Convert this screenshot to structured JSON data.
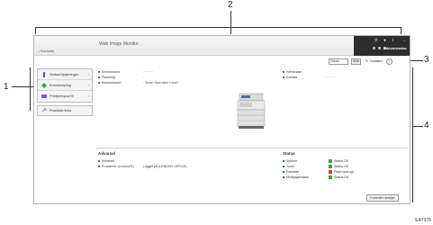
{
  "callouts": [
    "1",
    "2",
    "3",
    "4"
  ],
  "header": {
    "top_link": "• Startside",
    "app_title": "Web Image Monitor",
    "admin_label": "Administrator",
    "icons": [
      "search-icon",
      "user-icon",
      "info-icon",
      "logout-icon"
    ]
  },
  "toolbar": {
    "language": "Dansk",
    "small_button": "Skift",
    "refresh_label": "Opdatér",
    "help_label": "?"
  },
  "sidebar": {
    "items": [
      {
        "label": "Status/Oplysninger",
        "icon": "status-icon"
      },
      {
        "label": "Enhedsstyring",
        "icon": "device-icon"
      },
      {
        "label": "Printjob/spool fil",
        "icon": "printjob-icon"
      }
    ],
    "single": {
      "label": "Praktiske links",
      "icon": "link-icon"
    }
  },
  "main": {
    "info": [
      {
        "label": "Enhedsnavn",
        "value": "·········"
      },
      {
        "label": "Placering",
        "value": ":"
      },
      {
        "label": "Kommentarer",
        "value": ": Smart Operation Panel"
      },
      {
        "label": "Værtsnavn",
        "value": ":"
      },
      {
        "label": "Kontakt",
        "value": ": ···········"
      }
    ],
    "alert": {
      "title": "Advarsel",
      "rows": [
        {
          "label": "Advarsel",
          "value": ""
        },
        {
          "label": "Problemer (Lenovo01)",
          "value": "Logget på (LENOVO OFFICE)"
        }
      ]
    },
    "status": {
      "title": "Status",
      "rows": [
        {
          "label": "System",
          "value": "Status OK",
          "color": "#3ca33c"
        },
        {
          "label": "Toner",
          "value": "Status OK",
          "color": "#3ca33c"
        },
        {
          "label": "Kassette",
          "value": "Papir opbrugt",
          "color": "#d43b2b"
        },
        {
          "label": "Multipapirbakke",
          "value": "Status OK",
          "color": "#3ca33c"
        }
      ]
    },
    "bottom_button": "Kontrollér detaljer"
  },
  "figure_code": "EAT375",
  "colors": {
    "accent": "#3b63b0",
    "header_dark": "#2d2d2d",
    "ok": "#3ca33c",
    "error": "#d43b2b"
  }
}
